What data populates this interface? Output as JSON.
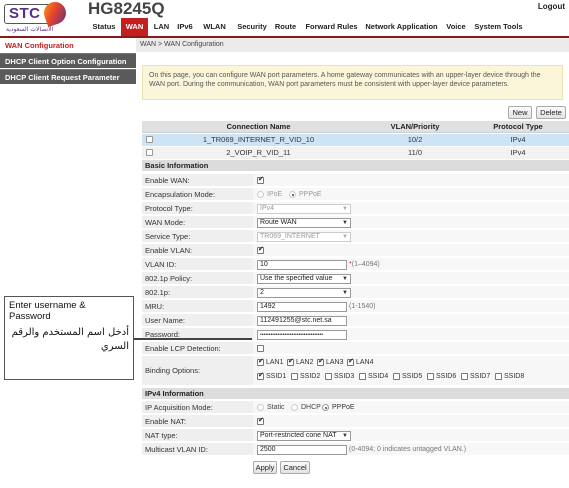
{
  "header": {
    "logo_text": "STC",
    "logo_arabic": "الاتصالات السعودية",
    "model": "HG8245Q",
    "logout": "Logout",
    "nav": [
      "Status",
      "WAN",
      "LAN",
      "IPv6",
      "WLAN",
      "Security",
      "Route",
      "Forward Rules",
      "Network Application",
      "Voice",
      "System Tools"
    ],
    "active_nav": "WAN",
    "accent_color": "#c41f1f"
  },
  "sidebar": {
    "items": [
      {
        "label": "WAN Configuration",
        "active": true
      },
      {
        "label": "DHCP Client Option Configuration",
        "active": false
      },
      {
        "label": "DHCP Client Request Parameter",
        "active": false
      }
    ]
  },
  "breadcrumb": "WAN > WAN Configuration",
  "info_text": "On this page, you can configure WAN port parameters. A home gateway communicates with an upper-layer device through the WAN port. During the communication, WAN port parameters must be consistent with upper-layer device parameters.",
  "buttons": {
    "new": "New",
    "delete": "Delete",
    "apply": "Apply",
    "cancel": "Cancel"
  },
  "wan_table": {
    "columns": [
      "Connection Name",
      "VLAN/Priority",
      "Protocol Type"
    ],
    "rows": [
      {
        "name": "1_TR069_INTERNET_R_VID_10",
        "vlan": "10/2",
        "protocol": "IPv4",
        "selected": true
      },
      {
        "name": "2_VOIP_R_VID_11",
        "vlan": "11/0",
        "protocol": "IPv4",
        "selected": false
      }
    ]
  },
  "basic": {
    "title": "Basic Information",
    "enable_wan": {
      "label": "Enable WAN:",
      "checked": true
    },
    "encapsulation": {
      "label": "Encapsulation Mode:",
      "options": [
        "IPoE",
        "PPPoE"
      ],
      "selected": "PPPoE"
    },
    "protocol_type": {
      "label": "Protocol Type:",
      "value": "IPv4"
    },
    "wan_mode": {
      "label": "WAN Mode:",
      "value": "Route WAN"
    },
    "service_type": {
      "label": "Service Type:",
      "value": "TR069_INTERNET"
    },
    "enable_vlan": {
      "label": "Enable VLAN:",
      "checked": true
    },
    "vlan_id": {
      "label": "VLAN ID:",
      "value": "10",
      "hint": "(1–4094)"
    },
    "policy": {
      "label": "802.1p Policy:",
      "value": "Use the specified value"
    },
    "p8021": {
      "label": "802.1p:",
      "value": "2"
    },
    "mru": {
      "label": "MRU:",
      "value": "1492",
      "hint": "(1-1540)"
    },
    "username": {
      "label": "User Name:",
      "value": "112491255@stc.net.sa"
    },
    "password": {
      "label": "Password:",
      "value": "••••••••••••••••••••••••••••••••••••"
    },
    "lcp": {
      "label": "Enable LCP Detection:",
      "checked": false
    },
    "binding": {
      "label": "Binding Options:",
      "lan": [
        {
          "name": "LAN1",
          "checked": true
        },
        {
          "name": "LAN2",
          "checked": true
        },
        {
          "name": "LAN3",
          "checked": true
        },
        {
          "name": "LAN4",
          "checked": true
        }
      ],
      "ssid": [
        {
          "name": "SSID1",
          "checked": true
        },
        {
          "name": "SSID2",
          "checked": false
        },
        {
          "name": "SSID3",
          "checked": false
        },
        {
          "name": "SSID4",
          "checked": false
        },
        {
          "name": "SSID5",
          "checked": false
        },
        {
          "name": "SSID6",
          "checked": false
        },
        {
          "name": "SSID7",
          "checked": false
        },
        {
          "name": "SSID8",
          "checked": false
        }
      ]
    }
  },
  "ipv4": {
    "title": "IPv4 Information",
    "acquisition": {
      "label": "IP Acquisition Mode:",
      "options": [
        "Static",
        "DHCP",
        "PPPoE"
      ],
      "selected": "PPPoE"
    },
    "enable_nat": {
      "label": "Enable NAT:",
      "checked": true
    },
    "nat_type": {
      "label": "NAT type:",
      "value": "Port-restricted cone NAT"
    },
    "multicast": {
      "label": "Multicast VLAN ID:",
      "value": "2500",
      "hint": "(0-4094; 0 indicates untagged VLAN.)"
    }
  },
  "annotation": {
    "english": "Enter username & Password",
    "arabic": "أدخل اسم المستخدم والرقم السري"
  }
}
